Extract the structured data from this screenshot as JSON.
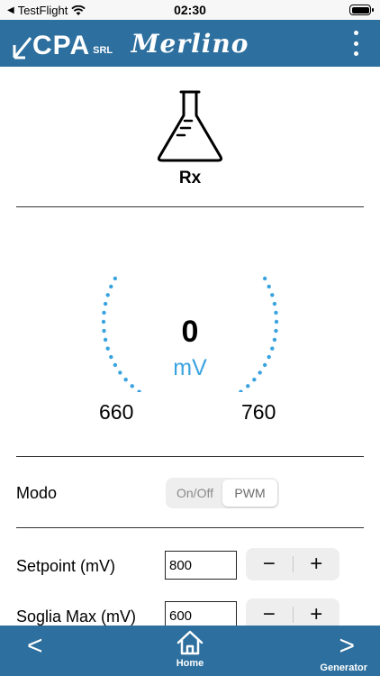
{
  "status_bar": {
    "carrier": "TestFlight",
    "time": "02:30"
  },
  "header": {
    "logo_text": "CPA",
    "logo_suffix": "SRL",
    "title": "Merlino"
  },
  "sensor": {
    "label": "Rx",
    "icon": "flask-icon"
  },
  "gauge": {
    "value": "0",
    "unit": "mV",
    "min_label": "660",
    "max_label": "760",
    "level": 0.5,
    "color": "#3aa3df"
  },
  "mode": {
    "label": "Modo",
    "options": [
      "On/Off",
      "PWM"
    ],
    "selected": "PWM"
  },
  "setpoint": {
    "label": "Setpoint (mV)",
    "value": "800",
    "minus": "−",
    "plus": "+"
  },
  "threshold_max": {
    "label": "Soglia Max (mV)",
    "value": "600",
    "minus": "−",
    "plus": "+"
  },
  "bottom_nav": {
    "prev": "<",
    "home_label": "Home",
    "next": ">",
    "next_label": "Generator"
  },
  "colors": {
    "brand": "#2d6f9e",
    "accent": "#3aa3df"
  }
}
